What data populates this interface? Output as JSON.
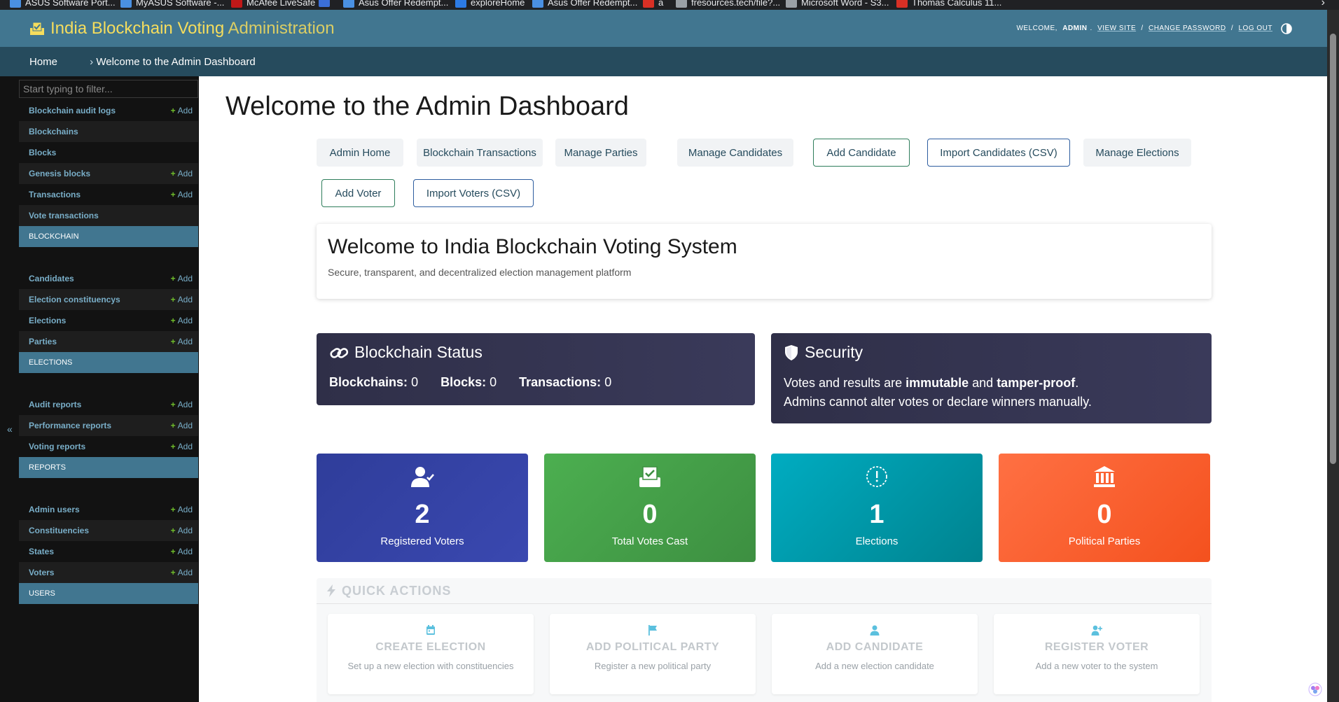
{
  "browser": {
    "bookmarks": [
      {
        "label": "ASUS Software Port...",
        "icon": "asus-icon",
        "color": "#4a90e2"
      },
      {
        "label": "MyASUS Software -...",
        "icon": "asus-icon",
        "color": "#4a90e2"
      },
      {
        "label": "McAfee LiveSafe",
        "icon": "mcafee-icon",
        "color": "#c01818"
      },
      {
        "label": "",
        "icon": "shield-icon",
        "color": "#3b6fd8"
      },
      {
        "label": "Asus Offer Redempt...",
        "icon": "asus-icon",
        "color": "#4a90e2"
      },
      {
        "label": "exploreHome",
        "icon": "k-icon",
        "color": "#2c7be5"
      },
      {
        "label": "Asus Offer Redempt...",
        "icon": "asus-icon",
        "color": "#4a90e2"
      },
      {
        "label": "a",
        "icon": "pdf-icon",
        "color": "#d93025"
      },
      {
        "label": "fresources.tech/file?...",
        "icon": "link-icon",
        "color": "#9aa0a6"
      },
      {
        "label": "Microsoft Word - S3...",
        "icon": "globe-icon",
        "color": "#9aa0a6"
      },
      {
        "label": "Thomas Calculus 11...",
        "icon": "pdf-icon",
        "color": "#d93025"
      }
    ],
    "more_label": "›"
  },
  "header": {
    "title_main": "India Blockchain Voting",
    "title_suffix": " Administration",
    "welcome_prefix": "Welcome, ",
    "username": "admin",
    "view_site": "View site",
    "change_password": "Change password",
    "log_out": "Log out",
    "separator": " / "
  },
  "breadcrumbs": {
    "home": "Home",
    "separator": " › ",
    "current": "Welcome to the Admin Dashboard"
  },
  "sidebar": {
    "filter_placeholder": "Start typing to filter...",
    "collapse_label": "«",
    "add_label": "Add",
    "sections": [
      {
        "caption": "Blockchain",
        "models": [
          {
            "name": "Blockchain audit logs",
            "add": true
          },
          {
            "name": "Blockchains",
            "add": false
          },
          {
            "name": "Blocks",
            "add": false
          },
          {
            "name": "Genesis blocks",
            "add": true
          },
          {
            "name": "Transactions",
            "add": true
          },
          {
            "name": "Vote transactions",
            "add": false
          }
        ]
      },
      {
        "caption": "Elections",
        "models": [
          {
            "name": "Candidates",
            "add": true
          },
          {
            "name": "Election constituencys",
            "add": true
          },
          {
            "name": "Elections",
            "add": true
          },
          {
            "name": "Parties",
            "add": true
          }
        ]
      },
      {
        "caption": "Reports",
        "models": [
          {
            "name": "Audit reports",
            "add": true
          },
          {
            "name": "Performance reports",
            "add": true
          },
          {
            "name": "Voting reports",
            "add": true
          }
        ]
      },
      {
        "caption": "Users",
        "models": [
          {
            "name": "Admin users",
            "add": true
          },
          {
            "name": "Constituencies",
            "add": true
          },
          {
            "name": "States",
            "add": true
          },
          {
            "name": "Voters",
            "add": true
          }
        ]
      }
    ]
  },
  "main": {
    "page_title": "Welcome to the Admin Dashboard",
    "buttons": [
      {
        "label": "Admin Home",
        "style": "plain"
      },
      {
        "label": "Blockchain Transactions",
        "style": "plain"
      },
      {
        "label": "Manage Parties",
        "style": "plain"
      },
      {
        "label": "Manage Candidates",
        "style": "plain"
      },
      {
        "label": "Add Candidate",
        "style": "green"
      },
      {
        "label": "Import Candidates (CSV)",
        "style": "blue"
      },
      {
        "label": "Manage Elections",
        "style": "plain"
      },
      {
        "label": "Add Voter",
        "style": "green"
      },
      {
        "label": "Import Voters (CSV)",
        "style": "blue"
      }
    ],
    "welcome": {
      "title": "Welcome to India Blockchain Voting System",
      "subtitle": "Secure, transparent, and decentralized election management platform"
    },
    "blockchain_status": {
      "title": "Blockchain Status",
      "stats": [
        {
          "label": "Blockchains:",
          "value": "0"
        },
        {
          "label": "Blocks:",
          "value": "0"
        },
        {
          "label": "Transactions:",
          "value": "0"
        }
      ]
    },
    "security": {
      "title": "Security",
      "line1_a": "Votes and results are ",
      "line1_b": "immutable",
      "line1_c": " and ",
      "line1_d": "tamper-proof",
      "line1_e": ".",
      "line2": "Admins cannot alter votes or declare winners manually."
    },
    "stats": {
      "voters": {
        "value": "2",
        "label": "Registered Voters"
      },
      "votes": {
        "value": "0",
        "label": "Total Votes Cast"
      },
      "elections": {
        "value": "1",
        "label": "Elections"
      },
      "parties": {
        "value": "0",
        "label": "Political Parties"
      }
    },
    "quick_actions": {
      "title": "QUICK ACTIONS",
      "items": [
        {
          "title": "CREATE ELECTION",
          "desc": "Set up a new election with constituencies",
          "icon": "calendar-icon"
        },
        {
          "title": "ADD POLITICAL PARTY",
          "desc": "Register a new political party",
          "icon": "flag-icon"
        },
        {
          "title": "ADD CANDIDATE",
          "desc": "Add a new election candidate",
          "icon": "user-icon"
        },
        {
          "title": "REGISTER VOTER",
          "desc": "Add a new voter to the system",
          "icon": "user-plus-icon"
        }
      ]
    }
  },
  "colors": {
    "header_bg": "#417690",
    "breadcrumb_bg": "#264b5d",
    "brand_yellow": "#f5dd5d",
    "link_blue": "#79aec8",
    "add_green": "#70bf2b",
    "stat_voters": "#2f3d9a",
    "stat_votes": "#4caf50",
    "stat_elections": "#00acc1",
    "stat_parties": "#ff7043"
  }
}
